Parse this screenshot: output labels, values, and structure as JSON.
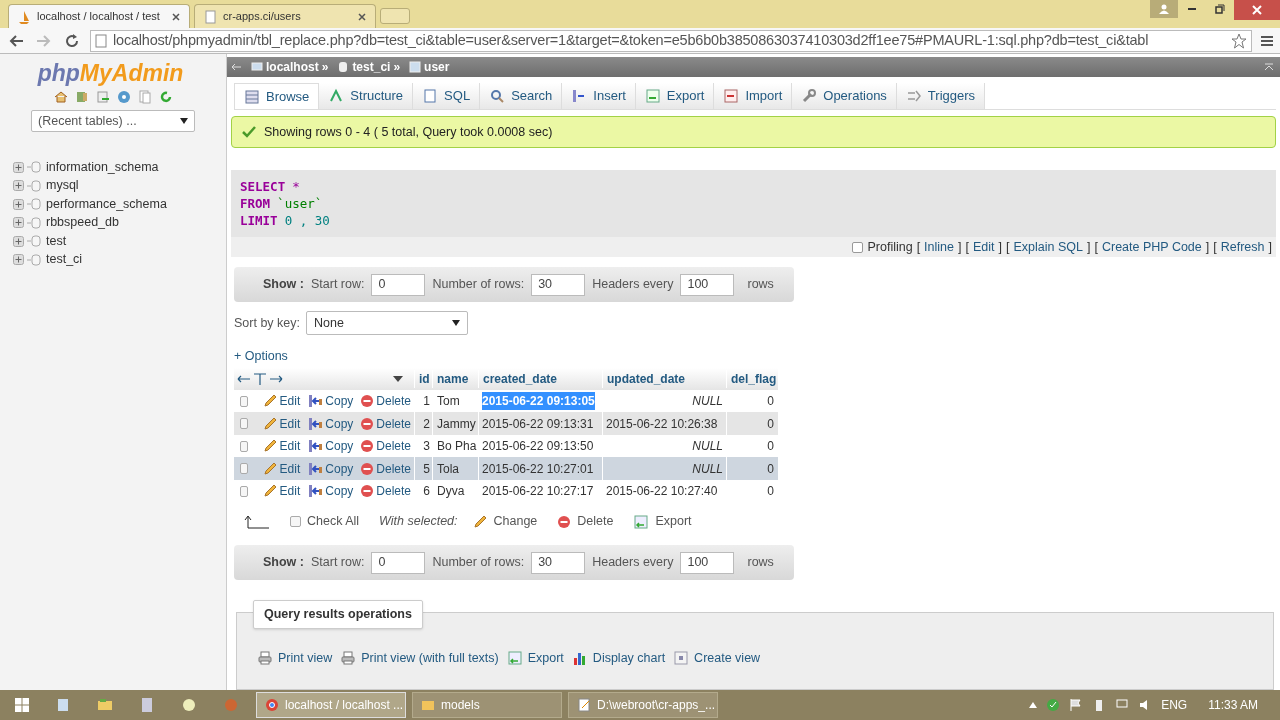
{
  "browser": {
    "tabs": [
      {
        "title": "localhost / localhost / test",
        "selected": true
      },
      {
        "title": "cr-apps.ci/users",
        "selected": false
      }
    ],
    "address": "localhost/phpmyadmin/tbl_replace.php?db=test_ci&table=user&server=1&target=&token=e5b6b0b3850863037410303d2ff1ee75#PMAURL-1:sql.php?db=test_ci&tabl"
  },
  "sidebar": {
    "logo_php": "php",
    "logo_myadmin": "MyAdmin",
    "recent_tables": "(Recent tables) ...",
    "databases": [
      "information_schema",
      "mysql",
      "performance_schema",
      "rbbspeed_db",
      "test",
      "test_ci"
    ]
  },
  "breadcrumb_separator": "»",
  "breadcrumb": [
    {
      "kind": "server",
      "text": "localhost"
    },
    {
      "kind": "database",
      "text": "test_ci"
    },
    {
      "kind": "table",
      "text": "user"
    }
  ],
  "tabs": [
    {
      "kind": "browse",
      "label": "Browse",
      "selected": true
    },
    {
      "kind": "structure",
      "label": "Structure",
      "selected": false
    },
    {
      "kind": "sql",
      "label": "SQL",
      "selected": false
    },
    {
      "kind": "search",
      "label": "Search",
      "selected": false
    },
    {
      "kind": "insert",
      "label": "Insert",
      "selected": false
    },
    {
      "kind": "export",
      "label": "Export",
      "selected": false
    },
    {
      "kind": "import",
      "label": "Import",
      "selected": false
    },
    {
      "kind": "operations",
      "label": "Operations",
      "selected": false
    },
    {
      "kind": "triggers",
      "label": "Triggers",
      "selected": false
    }
  ],
  "message": "Showing rows 0 - 4 ( 5 total, Query took 0.0008 sec)",
  "sql": [
    [
      {
        "kind": "keyword",
        "text": "SELECT"
      },
      {
        "kind": "operator",
        "text": "*"
      }
    ],
    [
      {
        "kind": "keyword",
        "text": "FROM"
      },
      {
        "kind": "identifier",
        "text": "`user`"
      }
    ],
    [
      {
        "kind": "keyword",
        "text": "LIMIT"
      },
      {
        "kind": "number",
        "text": "0 , 30"
      }
    ]
  ],
  "profiling": {
    "label": "Profiling",
    "checked": false,
    "bracket_open": "[",
    "bracket_close": "]",
    "links": [
      "Inline",
      "Edit",
      "Explain SQL",
      "Create PHP Code",
      "Refresh"
    ]
  },
  "navigation_top": {
    "show": "Show :",
    "fields": [
      {
        "label": "Start row:",
        "value": "0"
      },
      {
        "label": "Number of rows:",
        "value": "30"
      },
      {
        "label": "Headers every",
        "value": "100"
      }
    ],
    "suffix": "rows"
  },
  "sort": {
    "label": "Sort by key:",
    "value": "None"
  },
  "options": "+ Options",
  "table": {
    "columns": [
      "id",
      "name",
      "created_date",
      "updated_date",
      "del_flag"
    ],
    "rows": [
      {
        "checked": false,
        "hovered": false,
        "actions": [
          "Edit",
          "Copy",
          "Delete"
        ],
        "id": "1",
        "name": "Tom",
        "created_date": "2015-06-22 09:13:05",
        "created_text_selected": true,
        "updated_date": "NULL",
        "updated_null": true,
        "del_flag": "0"
      },
      {
        "checked": false,
        "hovered": false,
        "actions": [
          "Edit",
          "Copy",
          "Delete"
        ],
        "id": "2",
        "name": "Jammy",
        "created_date": "2015-06-22 09:13:31",
        "created_text_selected": false,
        "updated_date": "2015-06-22 10:26:38",
        "updated_null": false,
        "del_flag": "0"
      },
      {
        "checked": false,
        "hovered": false,
        "actions": [
          "Edit",
          "Copy",
          "Delete"
        ],
        "id": "3",
        "name": "Bo Pha",
        "created_date": "2015-06-22 09:13:50",
        "created_text_selected": false,
        "updated_date": "NULL",
        "updated_null": true,
        "del_flag": "0"
      },
      {
        "checked": false,
        "hovered": true,
        "actions": [
          "Edit",
          "Copy",
          "Delete"
        ],
        "id": "5",
        "name": "Tola",
        "created_date": "2015-06-22 10:27:01",
        "created_text_selected": false,
        "updated_date": "NULL",
        "updated_null": true,
        "del_flag": "0"
      },
      {
        "checked": false,
        "hovered": false,
        "actions": [
          "Edit",
          "Copy",
          "Delete"
        ],
        "id": "6",
        "name": "Dyva",
        "created_date": "2015-06-22 10:27:17",
        "created_text_selected": false,
        "updated_date": "2015-06-22 10:27:40",
        "updated_null": false,
        "del_flag": "0"
      }
    ]
  },
  "bulk": {
    "check_all": "Check All",
    "checked": false,
    "with_selected": "With selected:",
    "actions": [
      {
        "kind": "edit",
        "label": "Change"
      },
      {
        "kind": "delete",
        "label": "Delete"
      },
      {
        "kind": "export",
        "label": "Export"
      }
    ]
  },
  "navigation_bottom": {
    "show": "Show :",
    "fields": [
      {
        "label": "Start row:",
        "value": "0"
      },
      {
        "label": "Number of rows:",
        "value": "30"
      },
      {
        "label": "Headers every",
        "value": "100"
      }
    ],
    "suffix": "rows"
  },
  "query_operations": {
    "legend": "Query results operations",
    "links": [
      {
        "kind": "print",
        "label": "Print view"
      },
      {
        "kind": "print",
        "label": "Print view (with full texts)"
      },
      {
        "kind": "export",
        "label": "Export"
      },
      {
        "kind": "chart",
        "label": "Display chart"
      },
      {
        "kind": "view",
        "label": "Create view"
      }
    ]
  },
  "taskbar": {
    "windows": [
      {
        "kind": "chrome",
        "title": "localhost / localhost ...",
        "active": true
      },
      {
        "kind": "folder",
        "title": "models",
        "active": false
      },
      {
        "kind": "editor",
        "title": "D:\\webroot\\cr-apps_...",
        "active": false
      }
    ],
    "language": "ENG",
    "time": "11:33 AM"
  }
}
